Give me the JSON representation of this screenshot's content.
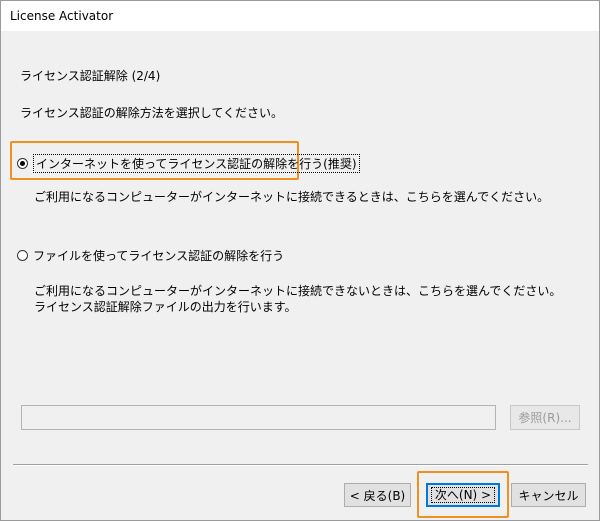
{
  "window": {
    "title": "License Activator"
  },
  "step": {
    "title": "ライセンス認証解除 (2/4)",
    "instruction": "ライセンス認証の解除方法を選択してください。"
  },
  "options": [
    {
      "label": "インターネットを使ってライセンス認証の解除を行う(推奨)",
      "selected": true,
      "description": [
        "ご利用になるコンピューターがインターネットに接続できるときは、こちらを選んでください。"
      ]
    },
    {
      "label": "ファイルを使ってライセンス認証の解除を行う",
      "selected": false,
      "description": [
        "ご利用になるコンピューターがインターネットに接続できないときは、こちらを選んでください。",
        "ライセンス認証解除ファイルの出力を行います。"
      ]
    }
  ],
  "file": {
    "path_value": "",
    "browse_label": "参照(R)..."
  },
  "footer": {
    "back_label": "< 戻る(B)",
    "next_label": "次へ(N) >",
    "cancel_label": "キャンセル"
  },
  "colors": {
    "highlight": "#f0901e",
    "accent": "#0078d7",
    "background": "#f0f0f0"
  }
}
